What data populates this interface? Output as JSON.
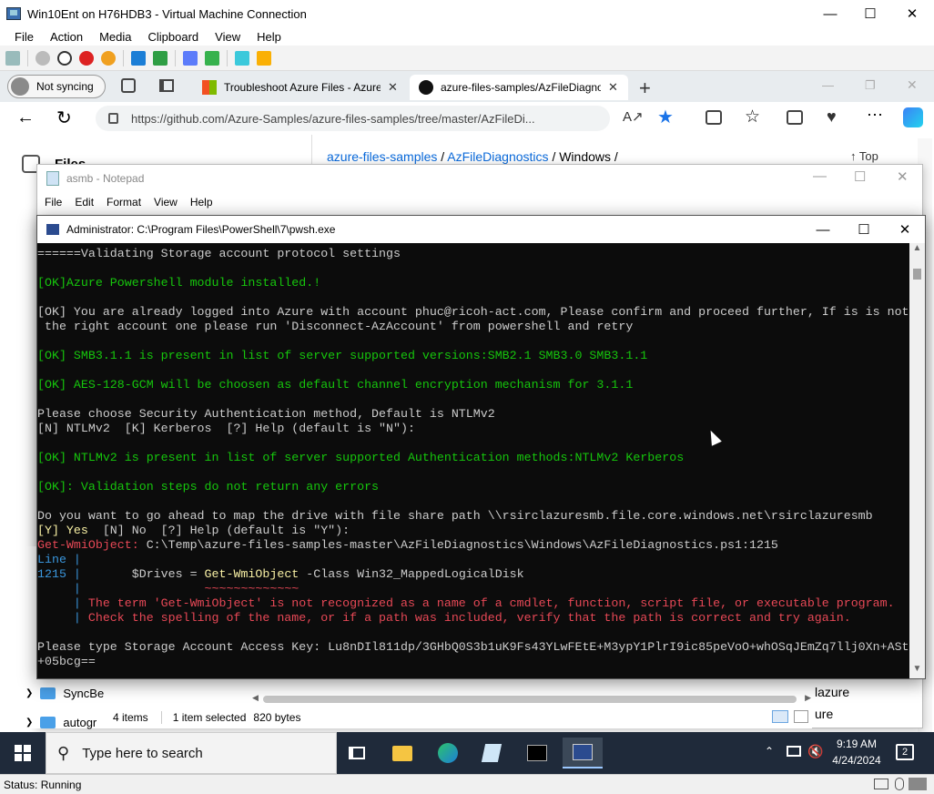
{
  "vm": {
    "title": "Win10Ent on H76HDB3 - Virtual Machine Connection",
    "menu": [
      "File",
      "Action",
      "Media",
      "Clipboard",
      "View",
      "Help"
    ],
    "status": "Status: Running"
  },
  "browser": {
    "profile": "Not syncing",
    "tabs": [
      {
        "title": "Troubleshoot Azure Files - Azure"
      },
      {
        "title": "azure-files-samples/AzFileDiagno"
      }
    ],
    "url": "https://github.com/Azure-Samples/azure-files-samples/tree/master/AzFileDi...",
    "breadcrumb": {
      "part1": "azure-files-samples",
      "sep1": "/",
      "part2": "AzFileDiagnostics",
      "sep2": "/",
      "part3": "Windows",
      "sep3": "/"
    },
    "top_link": "Top",
    "sidebar_title": "Files"
  },
  "notepad": {
    "title": "asmb - Notepad",
    "menu": [
      "File",
      "Edit",
      "Format",
      "View",
      "Help"
    ]
  },
  "explorer": {
    "status_items": "4 items",
    "status_selected": "1 item selected",
    "status_size": "820 bytes",
    "side_items": [
      "SyncBe",
      "autogr"
    ],
    "right_items": [
      "lazure",
      "ure"
    ]
  },
  "powershell": {
    "title": "Administrator: C:\\Program Files\\PowerShell\\7\\pwsh.exe",
    "lines": [
      [
        {
          "t": "======Validating Storage account protocol settings",
          "c": "w"
        }
      ],
      [
        {
          "t": "",
          "c": "w"
        }
      ],
      [
        {
          "t": "[OK]Azure Powershell module installed.!",
          "c": "g"
        }
      ],
      [
        {
          "t": "",
          "c": "w"
        }
      ],
      [
        {
          "t": "[OK] You are already logged into Azure with account phuc@ricoh-act.com, Please confirm and proceed further, If is is not",
          "c": "w"
        }
      ],
      [
        {
          "t": " the right account one please run 'Disconnect-AzAccount' from powershell and retry",
          "c": "w"
        }
      ],
      [
        {
          "t": "",
          "c": "w"
        }
      ],
      [
        {
          "t": "[OK] SMB3.1.1 is present in list of server supported versions:SMB2.1 SMB3.0 SMB3.1.1",
          "c": "g"
        }
      ],
      [
        {
          "t": "",
          "c": "w"
        }
      ],
      [
        {
          "t": "[OK] AES-128-GCM will be choosen as default channel encryption mechanism for 3.1.1",
          "c": "g"
        }
      ],
      [
        {
          "t": "",
          "c": "w"
        }
      ],
      [
        {
          "t": "Please choose Security Authentication method, Default is NTLMv2",
          "c": "w"
        }
      ],
      [
        {
          "t": "[N] NTLMv2  [K] Kerberos  [?] Help (default is \"N\"):",
          "c": "w"
        }
      ],
      [
        {
          "t": "",
          "c": "w"
        }
      ],
      [
        {
          "t": "[OK] NTLMv2 is present in list of server supported Authentication methods:NTLMv2 Kerberos",
          "c": "g"
        }
      ],
      [
        {
          "t": "",
          "c": "w"
        }
      ],
      [
        {
          "t": "[OK]: Validation steps do not return any errors",
          "c": "g"
        }
      ],
      [
        {
          "t": "",
          "c": "w"
        }
      ],
      [
        {
          "t": "Do you want to go ahead to map the drive with file share path \\\\rsirclazuresmb.file.core.windows.net\\rsirclazuresmb",
          "c": "w"
        }
      ],
      [
        {
          "t": "[Y] Yes",
          "c": "y"
        },
        {
          "t": "  [N] No  [?] Help (default is \"Y\"):",
          "c": "w"
        }
      ],
      [
        {
          "t": "Get-WmiObject: ",
          "c": "r"
        },
        {
          "t": "C:\\Temp\\azure-files-samples-master\\AzFileDiagnostics\\Windows\\AzFileDiagnostics.ps1:1215",
          "c": "w"
        }
      ],
      [
        {
          "t": "Line |",
          "c": "c"
        }
      ],
      [
        {
          "t": "1215 |",
          "c": "c"
        },
        {
          "t": "       $Drives = ",
          "c": "w"
        },
        {
          "t": "Get-WmiObject",
          "c": "y"
        },
        {
          "t": " -Class Win32_MappedLogicalDisk",
          "c": "w"
        }
      ],
      [
        {
          "t": "     |",
          "c": "c"
        },
        {
          "t": "                 ~~~~~~~~~~~~~",
          "c": "r"
        }
      ],
      [
        {
          "t": "     | ",
          "c": "c"
        },
        {
          "t": "The term 'Get-WmiObject' is not recognized as a name of a cmdlet, function, script file, or executable program.",
          "c": "r"
        }
      ],
      [
        {
          "t": "     | ",
          "c": "c"
        },
        {
          "t": "Check the spelling of the name, or if a path was included, verify that the path is correct and try again.",
          "c": "r"
        }
      ],
      [
        {
          "t": "",
          "c": "w"
        }
      ],
      [
        {
          "t": "Please type Storage Account Access Key: Lu8nDIl811dp/3GHbQ0S3b1uK9Fs43YLwFEtE+M3ypY1PlrI9ic85peVoO+whOSqJEmZq7llj0Xn+ASt",
          "c": "w"
        }
      ],
      [
        {
          "t": "+05bcg==",
          "c": "w"
        }
      ]
    ]
  },
  "taskbar": {
    "search_placeholder": "Type here to search",
    "time": "9:19 AM",
    "date": "4/24/2024",
    "notif_count": "2"
  },
  "colors": {
    "console_bg": "#0c0c0c",
    "ok_green": "#16c60c",
    "error_red": "#e74856",
    "prompt_yellow": "#f9f1a5",
    "link_blue": "#0969da"
  }
}
